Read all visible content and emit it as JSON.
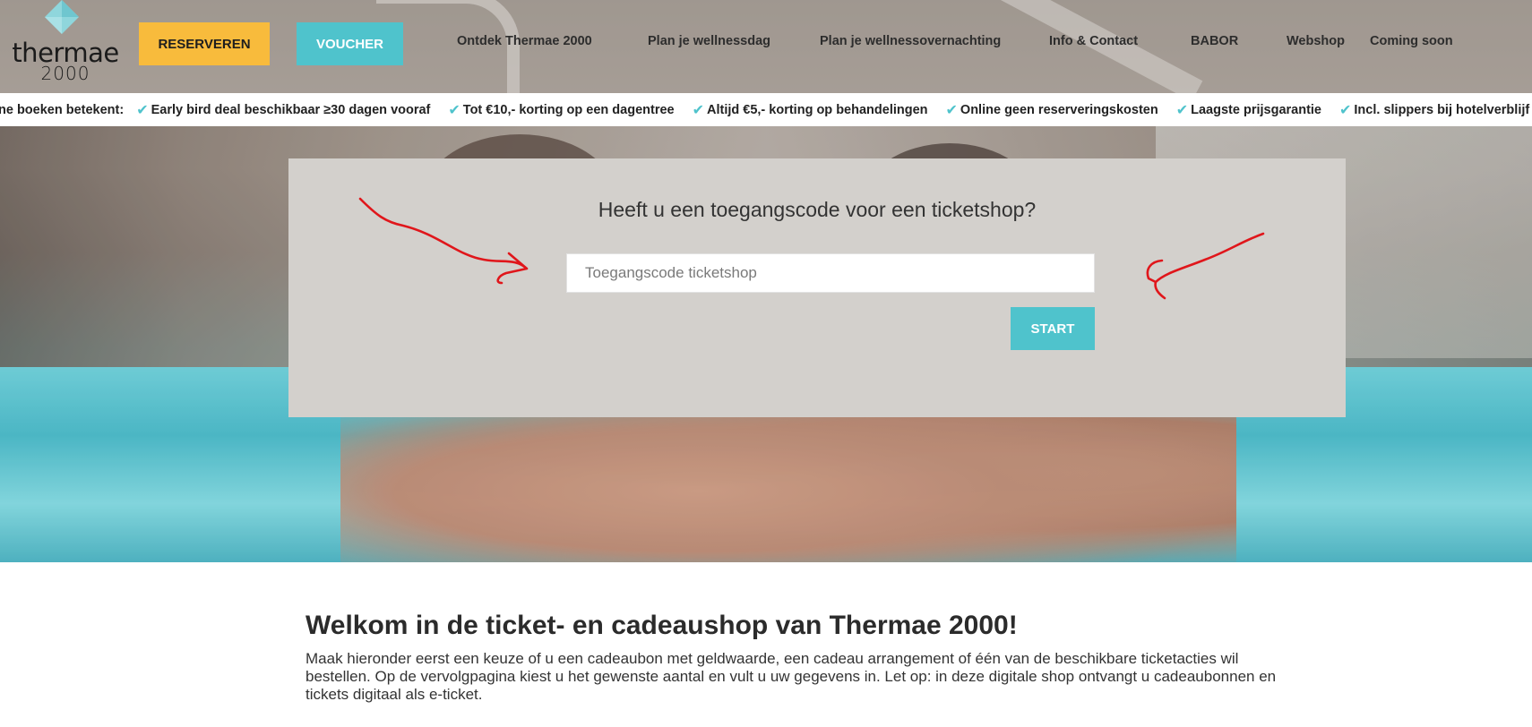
{
  "brand": {
    "logo_word": "thermae",
    "logo_number": "2000"
  },
  "header": {
    "reserve_label": "RESERVEREN",
    "voucher_label": "VOUCHER",
    "nav": [
      "Ontdek Thermae 2000",
      "Plan je wellnessdag",
      "Plan je wellnessovernachting",
      "Info & Contact",
      "BABOR",
      "Webshop",
      "Coming soon"
    ]
  },
  "usp": {
    "lead": "ne boeken betekent:",
    "items": [
      "Early bird deal beschikbaar ≥30 dagen vooraf",
      "Tot €10,- korting op een dagentree",
      "Altijd €5,- korting op behandelingen",
      "Online geen reserveringskosten",
      "Laagste prijsgarantie",
      "Incl. slippers bij hotelverblijf"
    ]
  },
  "ticketshop": {
    "title": "Heeft u een toegangscode voor een ticketshop?",
    "input_placeholder": "Toegangscode ticketshop",
    "input_value": "",
    "start_label": "START"
  },
  "welcome": {
    "title": "Welkom in de ticket- en cadeaushop van Thermae 2000!",
    "text": "Maak hieronder eerst een keuze of u een cadeaubon met geldwaarde, een cadeau arrangement of één van de beschikbare ticketacties wil bestellen. Op de vervolgpagina kiest u het gewenste aantal en vult u uw gegevens in. Let op: in deze digitale shop ontvangt u cadeaubonnen en tickets digitaal als e-ticket."
  },
  "colors": {
    "accent_teal": "#4fc3cc",
    "accent_yellow": "#f8bb3c",
    "panel_bg": "#d3d0cc",
    "annotation_red": "#e0161b"
  },
  "icons": {
    "usp_check": "checkmark-icon",
    "logo_mark": "diamond-logo-icon",
    "annotation": "hand-drawn-arrow-icon"
  }
}
